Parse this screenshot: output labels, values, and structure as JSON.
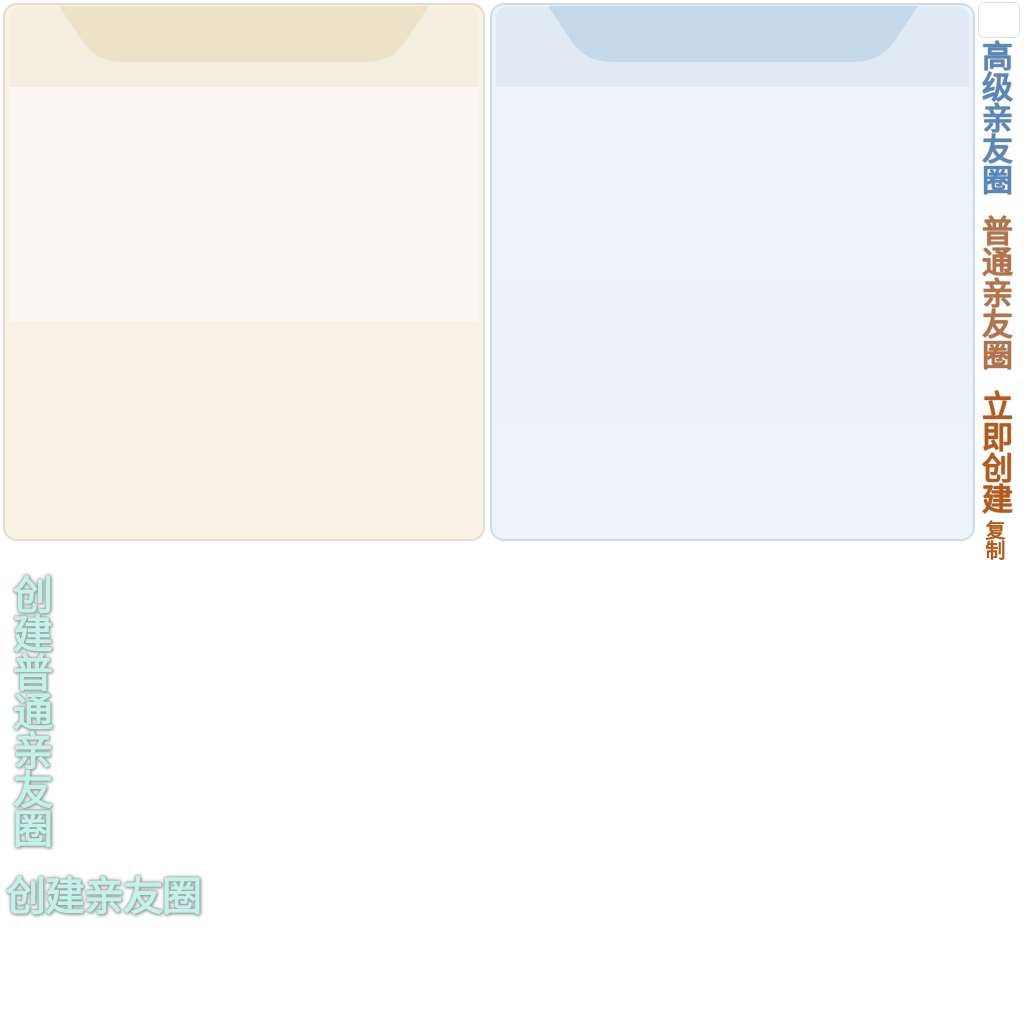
{
  "labels": {
    "advanced_circle": "高级亲友圈",
    "normal_circle": "普通亲友圈",
    "create_now": "立即创建",
    "copy": "复制"
  },
  "titles": {
    "create_normal_circle": "创建普通亲友圈",
    "create_circle": "创建亲友圈"
  },
  "colors": {
    "normal_card_bg": "#f7f3e7",
    "normal_card_tab": "#ede1c8",
    "advanced_card_bg": "#edf3fa",
    "advanced_card_tab": "#c6d9eb",
    "advanced_label": "#5b86b8",
    "normal_label": "#b0734a",
    "create_now_label": "#b45a1a",
    "glow_title": "#c6f1e8"
  }
}
